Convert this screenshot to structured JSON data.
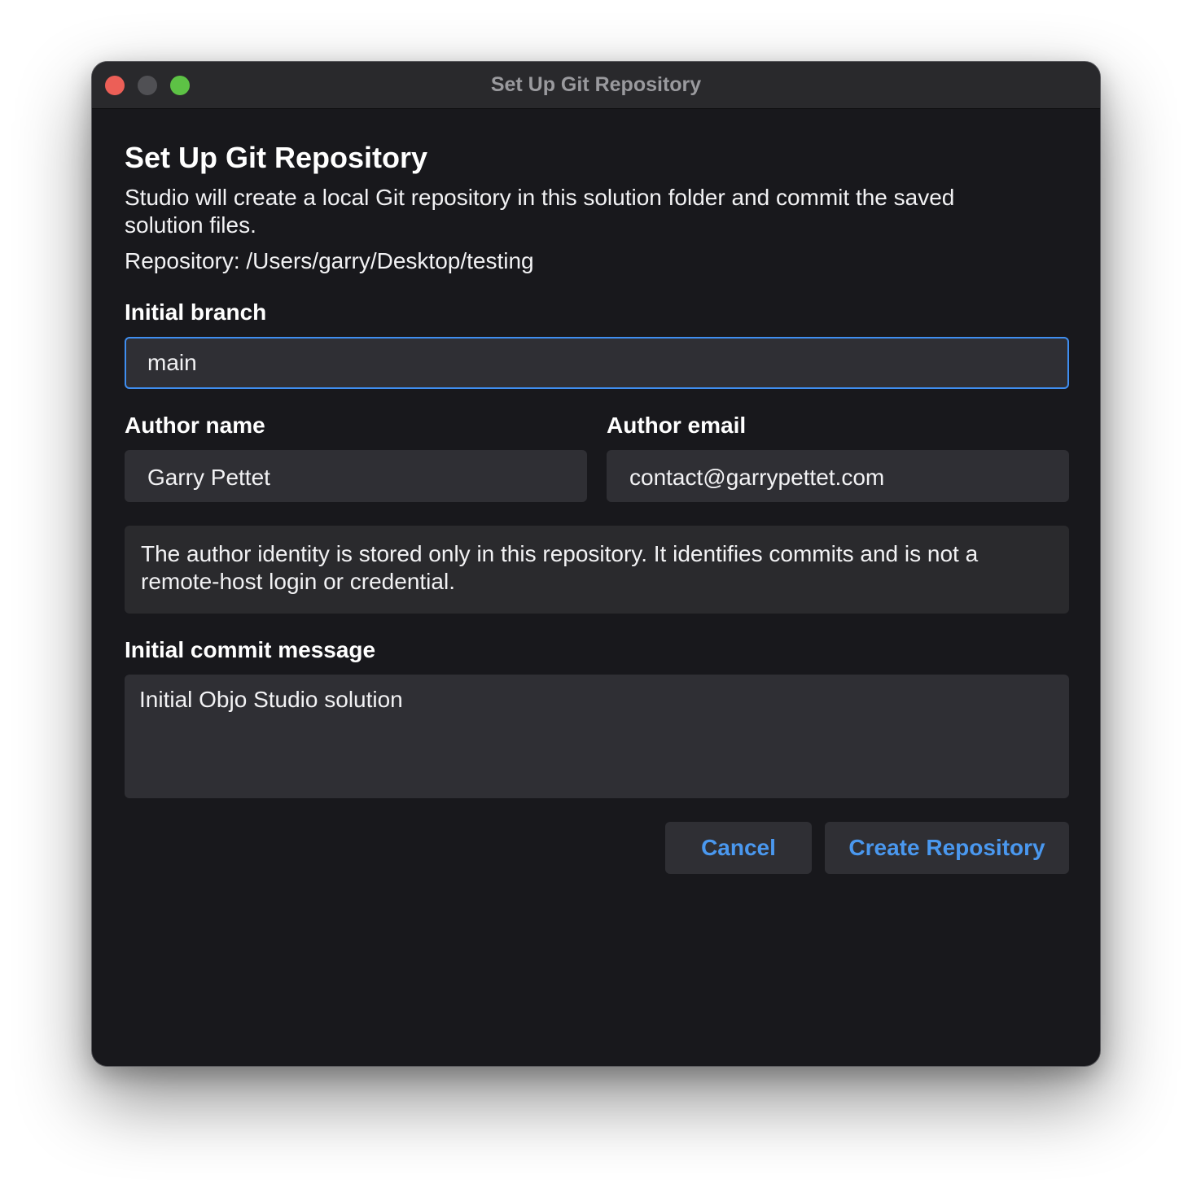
{
  "window": {
    "title": "Set Up Git Repository"
  },
  "dialog": {
    "heading": "Set Up Git Repository",
    "description": "Studio will create a local Git repository in this solution folder and commit the saved solution files.",
    "repository_line": "Repository: /Users/garry/Desktop/testing"
  },
  "form": {
    "branch_label": "Initial branch",
    "branch_value": "main",
    "author_name_label": "Author name",
    "author_name_value": "Garry Pettet",
    "author_email_label": "Author email",
    "author_email_value": "contact@garrypettet.com",
    "identity_note": "The author identity is stored only in this repository. It identifies commits and is not a remote-host login or credential.",
    "commit_label": "Initial commit message",
    "commit_value": "Initial Objo Studio solution"
  },
  "actions": {
    "cancel_label": "Cancel",
    "create_label": "Create Repository"
  },
  "colors": {
    "window_bg": "#18181c",
    "titlebar_bg": "#29292c",
    "field_bg": "#2f2f34",
    "accent": "#3f8ef0",
    "button_text": "#4a98ef",
    "close": "#ec5f57",
    "zoom": "#5dc245"
  }
}
